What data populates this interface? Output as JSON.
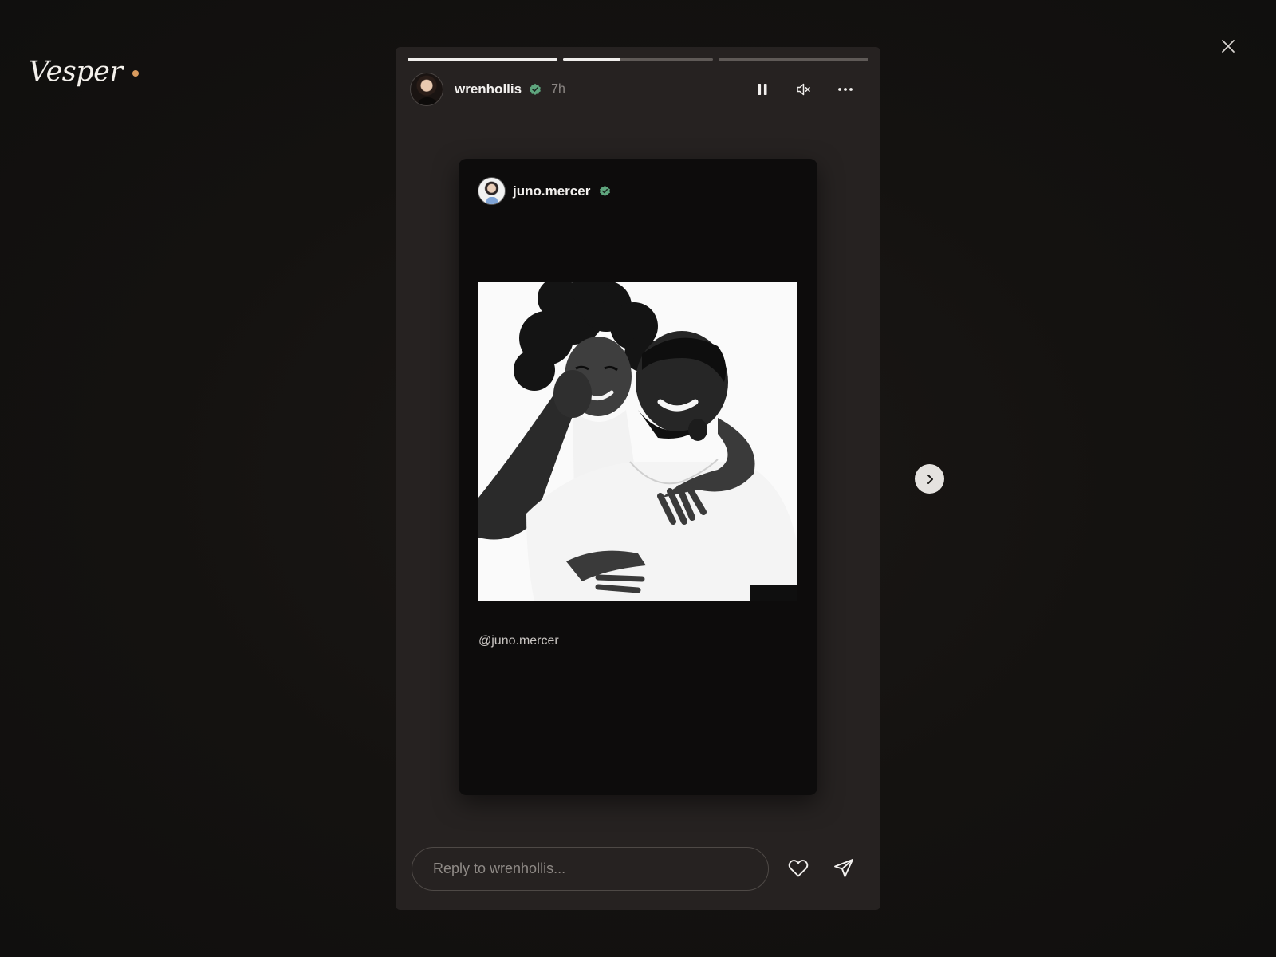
{
  "brand": {
    "name": "Vesper",
    "accent_color": "#d99b5e"
  },
  "viewer": {
    "close_icon": "close-icon"
  },
  "story": {
    "progress": [
      1.0,
      0.38,
      0.0
    ],
    "author": {
      "username": "wrenhollis",
      "verified": true,
      "time": "7h"
    },
    "controls": {
      "pause_icon": "pause-icon",
      "mute_icon": "muted-speaker-icon",
      "more_icon": "more-horizontal-icon"
    },
    "shared_post": {
      "username": "juno.mercer",
      "verified": true,
      "mention": "@juno.mercer"
    },
    "reply": {
      "placeholder": "Reply to wrenhollis..."
    },
    "actions": {
      "like_icon": "heart-icon",
      "send_icon": "send-icon"
    }
  },
  "navigation": {
    "next_icon": "chevron-right-icon"
  },
  "colors": {
    "verified": "#5fa67e",
    "background": "#141210",
    "panel": "#262221"
  }
}
